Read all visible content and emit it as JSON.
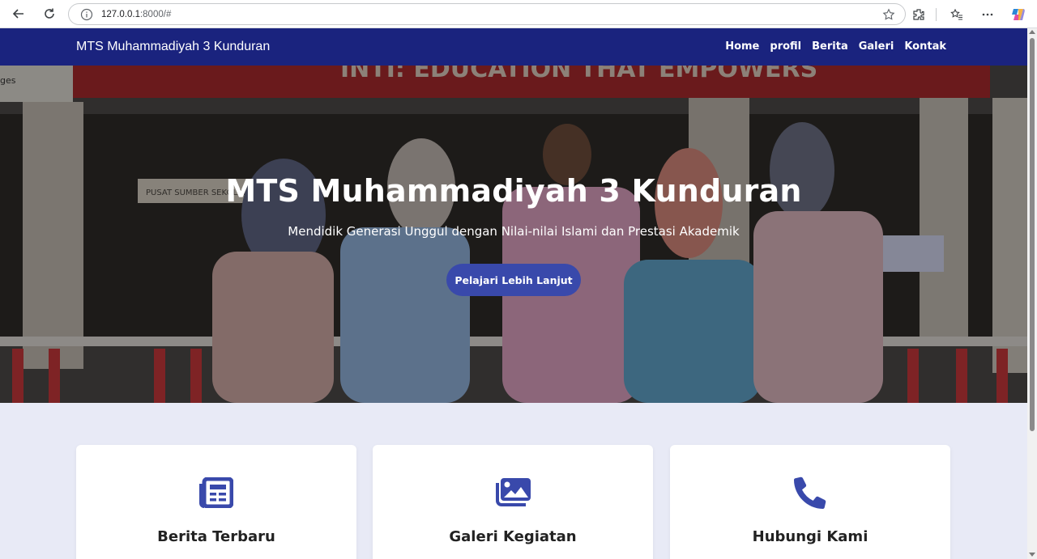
{
  "browser": {
    "url_host": "127.0.0.1",
    "url_rest": ":8000/#"
  },
  "navbar": {
    "brand": "MTS Muhammadiyah 3 Kunduran",
    "links": [
      "Home",
      "profil",
      "Berita",
      "Galeri",
      "Kontak"
    ]
  },
  "hero": {
    "title": "MTS Muhammadiyah 3 Kunduran",
    "subtitle": "Mendidik Generasi Unggul dengan Nilai-nilai Islami dan Prestasi Akademik",
    "button_label": "Pelajari Lebih Lanjut",
    "banner_text": "INTI: EDUCATION THAT EMPOWERS",
    "sign_text": "PUSAT SUMBER SEKOLAH",
    "left_edge_text": "ges"
  },
  "cards": [
    {
      "title": "Berita Terbaru",
      "icon": "newspaper-icon"
    },
    {
      "title": "Galeri Kegiatan",
      "icon": "images-icon"
    },
    {
      "title": "Hubungi Kami",
      "icon": "phone-icon"
    }
  ],
  "colors": {
    "navbar": "#1a237e",
    "accent": "#3949ab",
    "page_bg": "#e8eaf6"
  }
}
